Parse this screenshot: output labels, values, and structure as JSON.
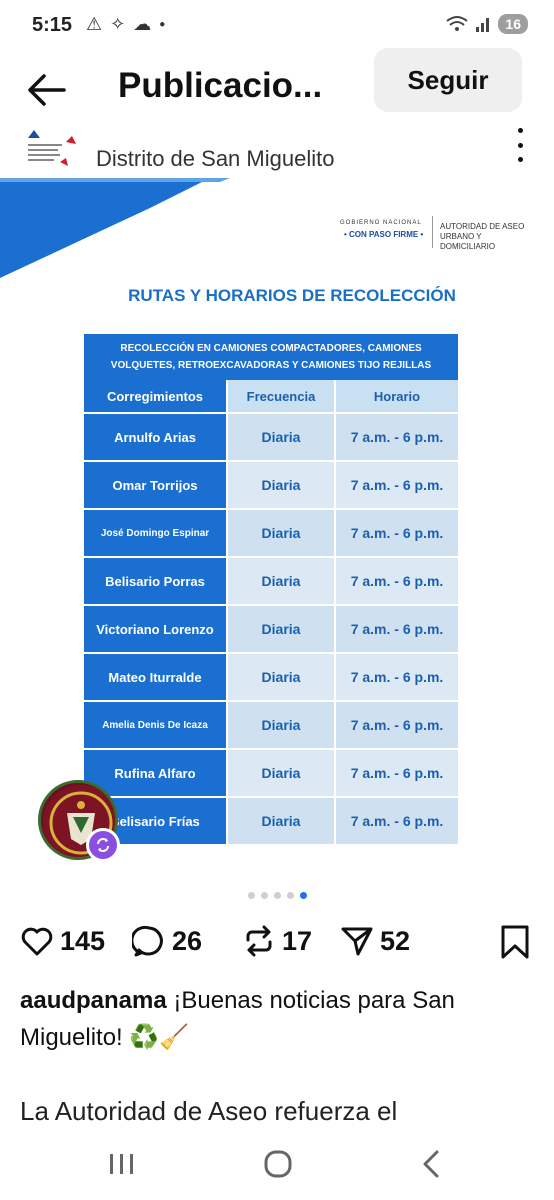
{
  "status_bar": {
    "time": "5:15",
    "battery": "16"
  },
  "header": {
    "title": "Publicacio...",
    "follow_label": "Seguir"
  },
  "post": {
    "account_subtitle": "Distrito de San Miguelito",
    "gov_line1": "GOBIERNO NACIONAL",
    "gov_line2": "• CON PASO FIRME •",
    "agency_line1": "AUTORIDAD DE ASEO",
    "agency_line2": "URBANO Y DOMICILIARIO",
    "heading": "RUTAS Y HORARIOS DE RECOLECCIÓN",
    "banner": "RECOLECCIÓN EN CAMIONES COMPACTADORES, CAMIONES VOLQUETES, RETROEXCAVADORAS Y CAMIONES TIJO REJILLAS",
    "columns": [
      "Corregimientos",
      "Frecuencia",
      "Horario"
    ],
    "rows": [
      {
        "name": "Arnulfo Arias",
        "freq": "Diaria",
        "time": "7 a.m. - 6 p.m."
      },
      {
        "name": "Omar Torrijos",
        "freq": "Diaria",
        "time": "7 a.m. - 6 p.m."
      },
      {
        "name": "José Domingo Espinar",
        "freq": "Diaria",
        "time": "7 a.m. - 6 p.m."
      },
      {
        "name": "Belisario Porras",
        "freq": "Diaria",
        "time": "7 a.m. - 6 p.m."
      },
      {
        "name": "Victoriano Lorenzo",
        "freq": "Diaria",
        "time": "7 a.m. - 6 p.m."
      },
      {
        "name": "Mateo Iturralde",
        "freq": "Diaria",
        "time": "7 a.m. - 6 p.m."
      },
      {
        "name": "Amelia Denis De Icaza",
        "freq": "Diaria",
        "time": "7 a.m. - 6 p.m."
      },
      {
        "name": "Rufina Alfaro",
        "freq": "Diaria",
        "time": "7 a.m. - 6 p.m."
      },
      {
        "name": "Belisario Frías",
        "freq": "Diaria",
        "time": "7 a.m. - 6 p.m."
      }
    ]
  },
  "carousel": {
    "total": 5,
    "active_index": 4
  },
  "actions": {
    "likes": "145",
    "comments": "26",
    "reposts": "17",
    "shares": "52"
  },
  "caption": {
    "username": "aaudpanama",
    "text": " ¡Buenas noticias para San Miguelito! ♻️🧹",
    "more_text": "La Autoridad de Aseo refuerza el"
  },
  "colors": {
    "brand_blue": "#1b6fd0",
    "cell_light": "#dce9f5",
    "active_dot": "#1a73e8"
  }
}
